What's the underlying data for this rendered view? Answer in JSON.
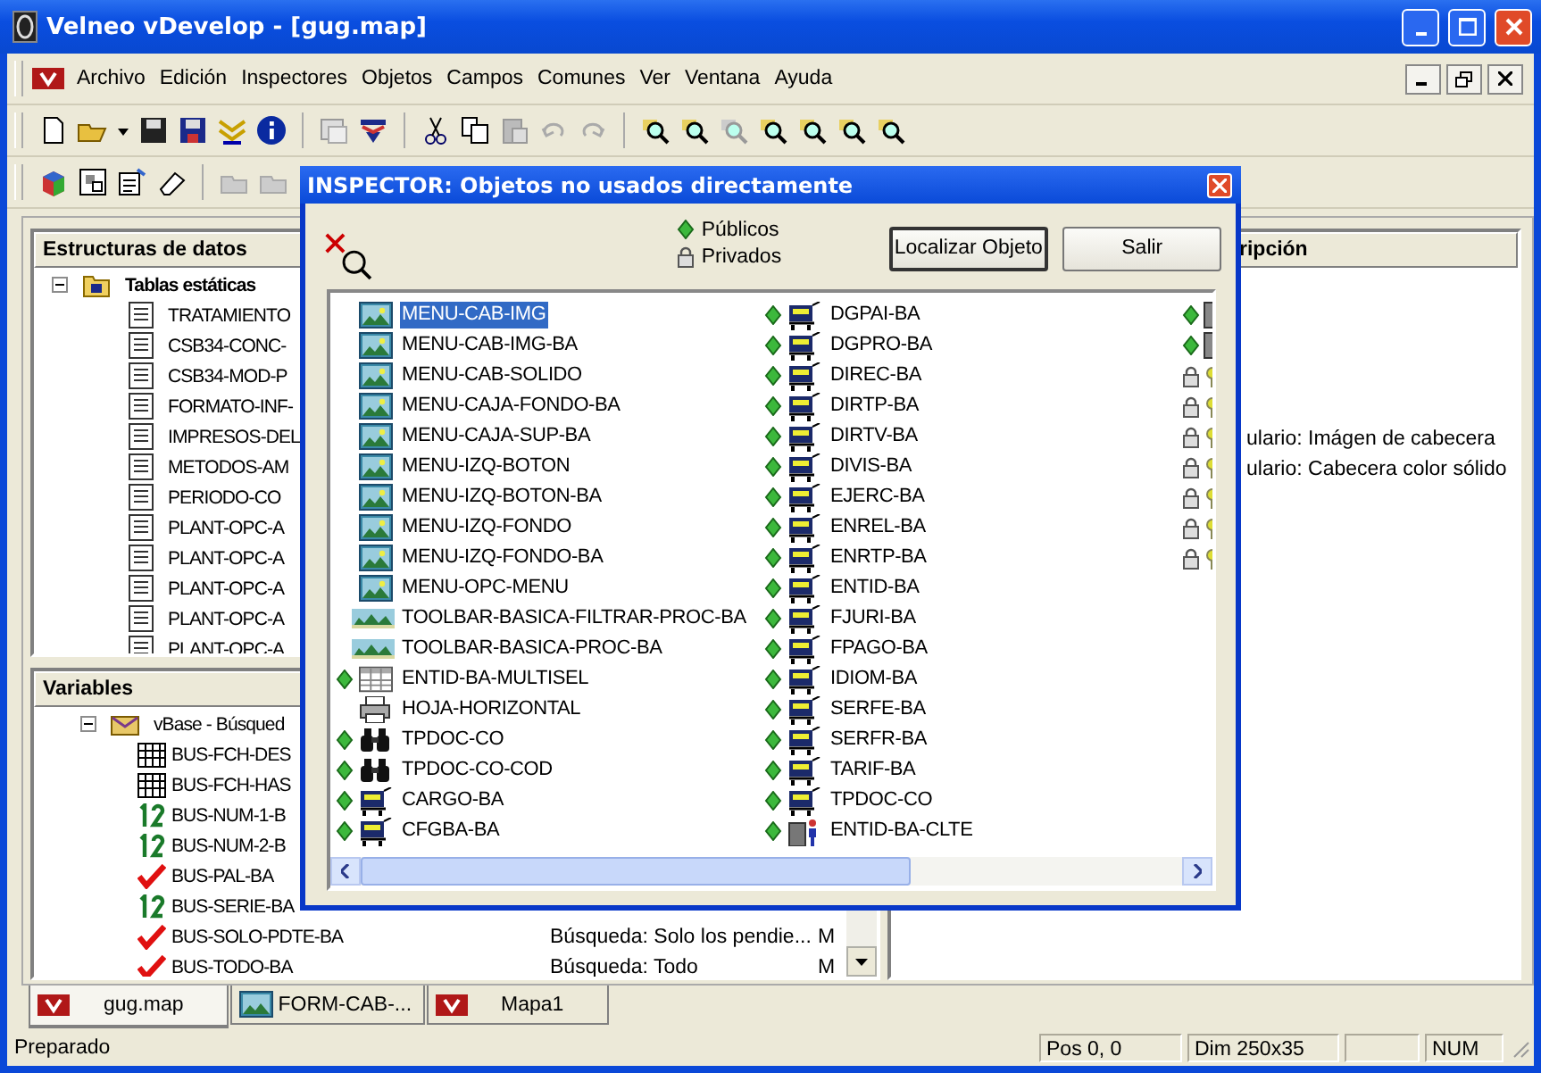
{
  "window": {
    "title": "Velneo vDevelop - [gug.map]"
  },
  "menu": [
    "Archivo",
    "Edición",
    "Inspectores",
    "Objetos",
    "Campos",
    "Comunes",
    "Ver",
    "Ventana",
    "Ayuda"
  ],
  "structures": {
    "title": "Estructuras de datos",
    "tree": [
      {
        "label": "Tablas estáticas",
        "expanded": true,
        "children": [
          {
            "label": "TRATAMIENTO"
          },
          {
            "label": "CSB34-CONC-"
          },
          {
            "label": "CSB34-MOD-P"
          },
          {
            "label": "FORMATO-INF-"
          },
          {
            "label": "IMPRESOS-DEL"
          },
          {
            "label": "METODOS-AM"
          },
          {
            "label": "PERIODO-CO"
          },
          {
            "label": "PLANT-OPC-A"
          },
          {
            "label": "PLANT-OPC-A"
          },
          {
            "label": "PLANT-OPC-A"
          },
          {
            "label": "PLANT-OPC-A"
          },
          {
            "label": "PLANT-OPC-A"
          }
        ]
      }
    ]
  },
  "variables": {
    "title": "Variables",
    "tree": [
      {
        "label": "vBase - Búsqued",
        "expanded": true,
        "children": [
          {
            "label": "BUS-FCH-DES",
            "kind": "date"
          },
          {
            "label": "BUS-FCH-HAS",
            "kind": "date"
          },
          {
            "label": "BUS-NUM-1-B",
            "kind": "number"
          },
          {
            "label": "BUS-NUM-2-B",
            "kind": "number"
          },
          {
            "label": "BUS-PAL-BA",
            "kind": "boolean"
          },
          {
            "label": "BUS-SERIE-BA",
            "kind": "number"
          },
          {
            "label": "BUS-SOLO-PDTE-BA",
            "kind": "boolean",
            "description": "Búsqueda: Solo los pendie...",
            "column_3": "M"
          },
          {
            "label": "BUS-TODO-BA",
            "kind": "boolean",
            "description": "Búsqueda: Todo",
            "column_3": "M"
          }
        ]
      }
    ]
  },
  "description_panel": {
    "title": "ripción",
    "lines": [
      "ulario: Imágen de cabecera",
      "ulario: Cabecera color sólido"
    ]
  },
  "tabs": [
    {
      "label": "gug.map",
      "selected": true,
      "kind": "logo"
    },
    {
      "label": "FORM-CAB-...",
      "selected": false,
      "kind": "image"
    },
    {
      "label": "Mapa1",
      "selected": false,
      "kind": "logo"
    }
  ],
  "status_bar": {
    "message": "Preparado",
    "panels": [
      "Pos 0, 0",
      "Dim 250x35",
      "NUM"
    ]
  },
  "dialog": {
    "title": "INSPECTOR: Objetos no usados directamente",
    "legend": [
      "Públicos",
      "Privados"
    ],
    "buttons": [
      {
        "label": "Localizar Objeto",
        "default": true
      },
      {
        "label": "Salir",
        "default": false
      }
    ],
    "columns": [
      [
        {
          "name": "MENU-CAB-IMG",
          "kind": "image",
          "public": false,
          "selected": true
        },
        {
          "name": "MENU-CAB-IMG-BA",
          "kind": "image",
          "public": false,
          "selected": false
        },
        {
          "name": "MENU-CAB-SOLIDO",
          "kind": "image",
          "public": false,
          "selected": false
        },
        {
          "name": "MENU-CAJA-FONDO-BA",
          "kind": "image",
          "public": false,
          "selected": false
        },
        {
          "name": "MENU-CAJA-SUP-BA",
          "kind": "image",
          "public": false,
          "selected": false
        },
        {
          "name": "MENU-IZQ-BOTON",
          "kind": "image",
          "public": false,
          "selected": false
        },
        {
          "name": "MENU-IZQ-BOTON-BA",
          "kind": "image",
          "public": false,
          "selected": false
        },
        {
          "name": "MENU-IZQ-FONDO",
          "kind": "image",
          "public": false,
          "selected": false
        },
        {
          "name": "MENU-IZQ-FONDO-BA",
          "kind": "image",
          "public": false,
          "selected": false
        },
        {
          "name": "MENU-OPC-MENU",
          "kind": "image",
          "public": false,
          "selected": false
        },
        {
          "name": "TOOLBAR-BASICA-FILTRAR-PROC-BA",
          "kind": "toolbar",
          "public": false,
          "selected": false
        },
        {
          "name": "TOOLBAR-BASICA-PROC-BA",
          "kind": "toolbar",
          "public": false,
          "selected": false
        },
        {
          "name": "ENTID-BA-MULTISEL",
          "kind": "grid",
          "public": true,
          "selected": false
        },
        {
          "name": "HOJA-HORIZONTAL",
          "kind": "printer",
          "public": false,
          "selected": false
        },
        {
          "name": "TPDOC-CO",
          "kind": "binoculars",
          "public": true,
          "selected": false
        },
        {
          "name": "TPDOC-CO-COD",
          "kind": "binoculars",
          "public": true,
          "selected": false
        },
        {
          "name": "CARGO-BA",
          "kind": "cart",
          "public": true,
          "selected": false
        },
        {
          "name": "CFGBA-BA",
          "kind": "cart",
          "public": true,
          "selected": false
        }
      ],
      [
        {
          "name": "DGPAI-BA",
          "kind": "cart",
          "public": true,
          "selected": false
        },
        {
          "name": "DGPRO-BA",
          "kind": "cart",
          "public": true,
          "selected": false
        },
        {
          "name": "DIREC-BA",
          "kind": "cart",
          "public": true,
          "selected": false
        },
        {
          "name": "DIRTP-BA",
          "kind": "cart",
          "public": true,
          "selected": false
        },
        {
          "name": "DIRTV-BA",
          "kind": "cart",
          "public": true,
          "selected": false
        },
        {
          "name": "DIVIS-BA",
          "kind": "cart",
          "public": true,
          "selected": false
        },
        {
          "name": "EJERC-BA",
          "kind": "cart",
          "public": true,
          "selected": false
        },
        {
          "name": "ENREL-BA",
          "kind": "cart",
          "public": true,
          "selected": false
        },
        {
          "name": "ENRTP-BA",
          "kind": "cart",
          "public": true,
          "selected": false
        },
        {
          "name": "ENTID-BA",
          "kind": "cart",
          "public": true,
          "selected": false
        },
        {
          "name": "FJURI-BA",
          "kind": "cart",
          "public": true,
          "selected": false
        },
        {
          "name": "FPAGO-BA",
          "kind": "cart",
          "public": true,
          "selected": false
        },
        {
          "name": "IDIOM-BA",
          "kind": "cart",
          "public": true,
          "selected": false
        },
        {
          "name": "SERFE-BA",
          "kind": "cart",
          "public": true,
          "selected": false
        },
        {
          "name": "SERFR-BA",
          "kind": "cart",
          "public": true,
          "selected": false
        },
        {
          "name": "TARIF-BA",
          "kind": "cart",
          "public": true,
          "selected": false
        },
        {
          "name": "TPDOC-CO",
          "kind": "cart",
          "public": true,
          "selected": false
        },
        {
          "name": "ENTID-BA-CLTE",
          "kind": "form-user",
          "public": true,
          "selected": false
        }
      ],
      [
        {
          "kind": "block",
          "public": true
        },
        {
          "kind": "block",
          "public": true
        },
        {
          "kind": "bulb",
          "public": false
        },
        {
          "kind": "bulb",
          "public": false
        },
        {
          "kind": "bulb",
          "public": false
        },
        {
          "kind": "bulb",
          "public": false
        },
        {
          "kind": "bulb",
          "public": false
        },
        {
          "kind": "bulb",
          "public": false
        },
        {
          "kind": "bulb",
          "public": false
        }
      ]
    ]
  }
}
